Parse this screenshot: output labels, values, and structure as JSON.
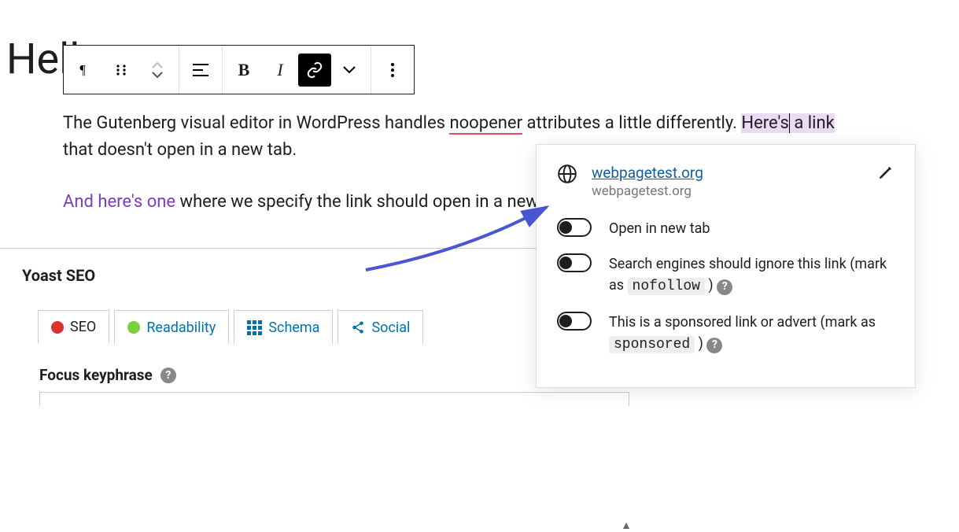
{
  "post": {
    "title": "Hell",
    "paragraph1_a": "The Gutenberg visual editor in WordPress handles ",
    "paragraph1_noopener": "noopener",
    "paragraph1_b": " attributes a little differently. ",
    "paragraph1_link_a": "Here's",
    "paragraph1_link_b": " a link",
    "paragraph1_c": " that doesn't open in a new tab.",
    "paragraph2_link": "And here's one",
    "paragraph2_rest": " where we specify the link should open in a new tab."
  },
  "toolbar": {
    "bold": "B",
    "italic": "I"
  },
  "link_popover": {
    "url_display": "webpagetest.org",
    "url_sub": "webpagetest.org",
    "open_new_tab": "Open in new tab",
    "nofollow_a": "Search engines should ignore this link (mark as ",
    "nofollow_code": "nofollow",
    "nofollow_b": " )",
    "sponsored_a": "This is a sponsored link or advert (mark as ",
    "sponsored_code": "sponsored",
    "sponsored_b": " )"
  },
  "yoast": {
    "title": "Yoast SEO",
    "tabs": {
      "seo": "SEO",
      "readability": "Readability",
      "schema": "Schema",
      "social": "Social"
    },
    "focus_keyphrase": "Focus keyphrase"
  }
}
